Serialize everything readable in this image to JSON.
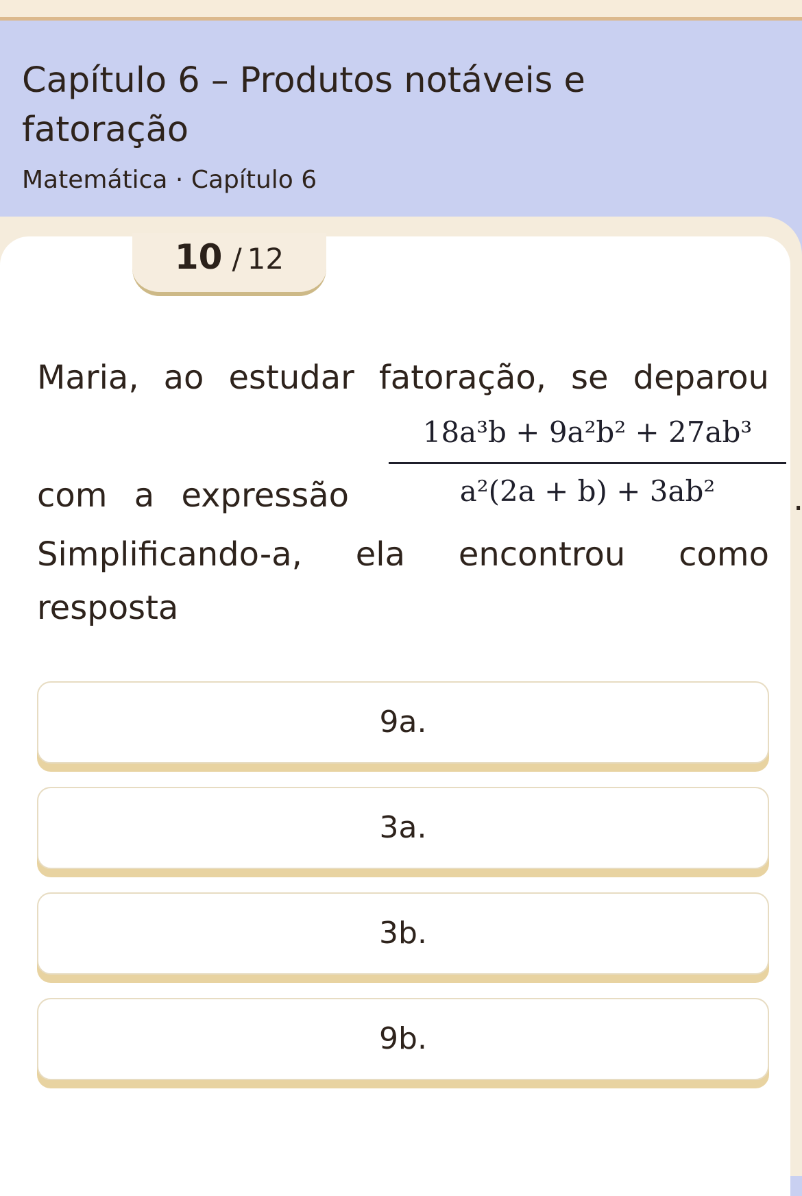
{
  "header": {
    "title": "Capítulo 6 – Produtos notáveis e fatoração",
    "subtitle": "Matemática · Capítulo 6"
  },
  "progress": {
    "current": "10",
    "separator": "/",
    "total": "12"
  },
  "question": {
    "line1": [
      "Maria,",
      "ao",
      "estudar",
      "fatoração,",
      "se",
      "deparou"
    ],
    "line2_left": "com a expressão",
    "formula": {
      "numerator": "18a³b + 9a²b² + 27ab³",
      "denominator": "a²(2a + b) + 3ab²"
    },
    "period": ".",
    "line3": [
      "Simplificando-a,",
      "ela",
      "encontrou",
      "como"
    ],
    "line4": "resposta"
  },
  "options": [
    {
      "label": "9a."
    },
    {
      "label": "3a."
    },
    {
      "label": "3b."
    },
    {
      "label": "9b."
    }
  ]
}
